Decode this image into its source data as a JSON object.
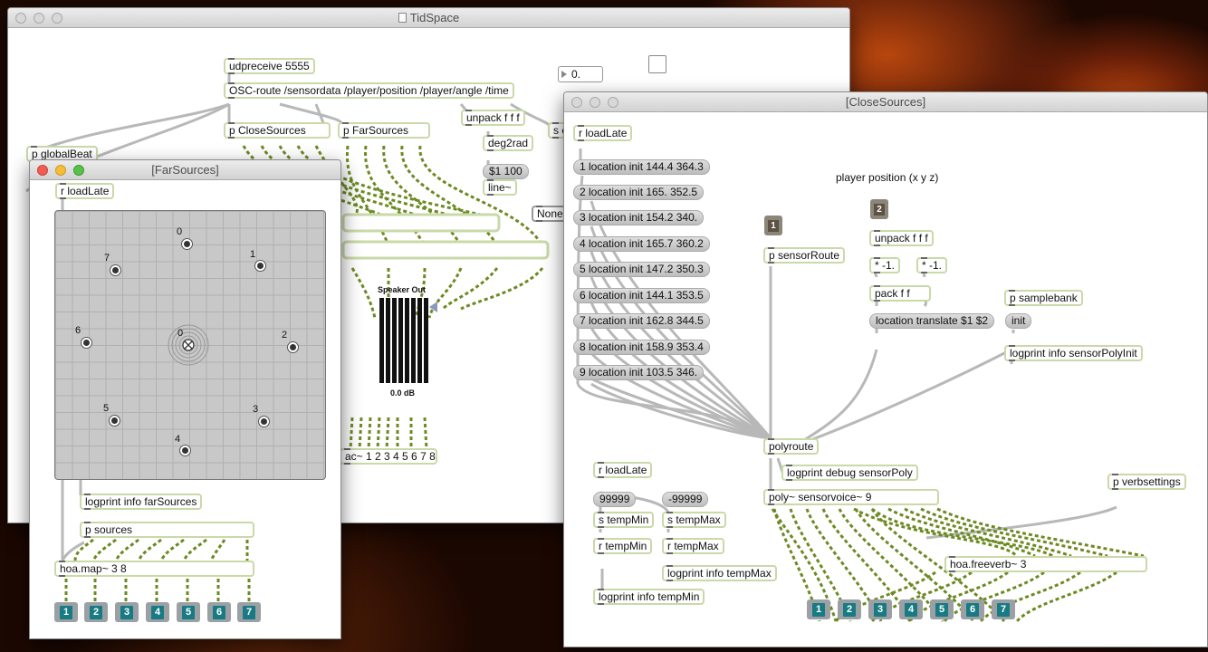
{
  "tidspace": {
    "title": "TidSpace",
    "objects": {
      "udpreceive": "udpreceive 5555",
      "oscroute": "OSC-route /sensordata /player/position /player/angle /time",
      "close_sources": "p CloseSources",
      "far_sources": "p FarSources",
      "unpack": "unpack f f f",
      "deg2rad": "deg2rad",
      "msg_100": "$1 100",
      "line": "line~",
      "global_beat": "p globalBeat",
      "send_c": "s c",
      "none_menu": "None",
      "dac": "ac~ 1 2 3 4 5 6 7 8"
    },
    "number_box": "0.",
    "meter_title": "Speaker Out",
    "meter_db": "0.0 dB"
  },
  "farsources": {
    "title": "[FarSources]",
    "objects": {
      "loadlate": "r loadLate",
      "logprint": "logprint info farSources",
      "sources": "p sources",
      "hoamap": "hoa.map~ 3 8"
    },
    "map_sources": [
      {
        "label": "0"
      },
      {
        "label": "1"
      },
      {
        "label": "2"
      },
      {
        "label": "3"
      },
      {
        "label": "4"
      },
      {
        "label": "5"
      },
      {
        "label": "6"
      },
      {
        "label": "7"
      }
    ],
    "listener_label": "0",
    "outlets": [
      "1",
      "2",
      "3",
      "4",
      "5",
      "6",
      "7"
    ]
  },
  "closesources": {
    "title": "[CloseSources]",
    "objects": {
      "loadlate": "r loadLate",
      "sensorroute": "p sensorRoute",
      "unpack": "unpack f f f",
      "mul_x": "* -1.",
      "mul_y": "* -1.",
      "pack": "pack f f",
      "translate": "location translate $1 $2",
      "samplebank": "p samplebank",
      "init": "init",
      "logprint_poly_init": "logprint info sensorPolyInit",
      "polyroute": "polyroute",
      "logprint_debug": "logprint debug sensorPoly",
      "poly": "poly~ sensorvoice~ 9",
      "freeverb": "hoa.freeverb~ 3",
      "verbsettings": "p verbsettings",
      "loadlate2": "r loadLate",
      "val_max": "99999",
      "val_min": "-99999",
      "s_tempmin": "s tempMin",
      "s_tempmax": "s tempMax",
      "r_tempmin": "r tempMin",
      "r_tempmax": "r tempMax",
      "logprint_tempmax": "logprint info tempMax",
      "logprint_tempmin": "logprint info tempMin"
    },
    "player_position_comment": "player position (x y z)",
    "inlets": [
      "1",
      "2"
    ],
    "location_messages": [
      "1 location init 144.4 364.3",
      "2 location init 165. 352.5",
      "3 location init 154.2 340.",
      "4 location init 165.7 360.2",
      "5 location init 147.2 350.3",
      "6 location init 144.1 353.5",
      "7 location init 162.8 344.5",
      "8 location init 158.9 353.4",
      "9 location init 103.5 346."
    ],
    "outlets": [
      "1",
      "2",
      "3",
      "4",
      "5",
      "6",
      "7"
    ]
  },
  "colors": {
    "object_border": "#c9d9a8",
    "signal_cable": "#7d9b2a",
    "outlet_blue": "#187a82"
  }
}
